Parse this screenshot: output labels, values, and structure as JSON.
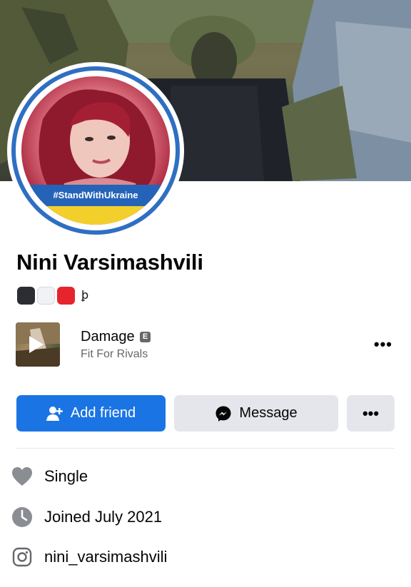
{
  "profile": {
    "name": "Nini Varsimashvili",
    "avatar_frame_text": "#StandWithUkraine",
    "status_emoji": [
      "black-large-square",
      "white-large-square",
      "red-large-square"
    ],
    "status_glyph": "ꝧ"
  },
  "music": {
    "title": "Damage",
    "explicit_badge": "E",
    "artist": "Fit For Rivals",
    "more": "•••"
  },
  "actions": {
    "add_friend": "Add friend",
    "message": "Message",
    "more": "•••"
  },
  "details": [
    {
      "icon": "heart-icon",
      "text": "Single"
    },
    {
      "icon": "clock-icon",
      "text": "Joined July 2021"
    },
    {
      "icon": "instagram-icon",
      "text": "nini_varsimashvili"
    }
  ],
  "colors": {
    "primary_button": "#1b74e4",
    "secondary_button": "#e4e6eb",
    "muted_text": "#65676b",
    "ukraine_blue": "#2463b8",
    "ukraine_yellow": "#f3cf2c"
  }
}
